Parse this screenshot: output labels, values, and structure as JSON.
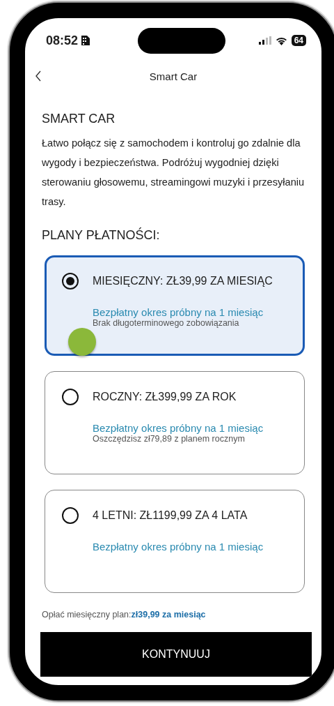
{
  "status_bar": {
    "time": "08:52",
    "battery": "64"
  },
  "header": {
    "title": "Smart Car"
  },
  "section_title": "SMART CAR",
  "description": "Łatwo połącz się z samochodem i kontroluj go zdalnie dla wygody i bezpieczeństwa. Podróżuj wygodniej dzięki sterowaniu głosowemu, streamingowi muzyki i przesyłaniu trasy.",
  "plans_title": "PLANY PŁATNOŚCI:",
  "plans": [
    {
      "label": "MIESIĘCZNY: ZŁ39,99 ZA MIESIĄC",
      "trial": "Bezpłatny okres próbny na 1 miesiąc",
      "note": "Brak długoterminowego zobowiązania",
      "selected": true
    },
    {
      "label": "ROCZNY: ZŁ399,99 ZA ROK",
      "trial": "Bezpłatny okres próbny na 1 miesiąc",
      "note": "Oszczędzisz zł79,89 z planem rocznym",
      "selected": false
    },
    {
      "label": "4 LETNI: ZŁ1199,99 ZA 4 LATA",
      "trial": "Bezpłatny okres próbny na 1 miesiąc",
      "selected": false
    }
  ],
  "summary": {
    "label": "Opłać miesięczny plan:",
    "price": "zł39,99 za miesiąc"
  },
  "continue_button": "KONTYNUUJ"
}
